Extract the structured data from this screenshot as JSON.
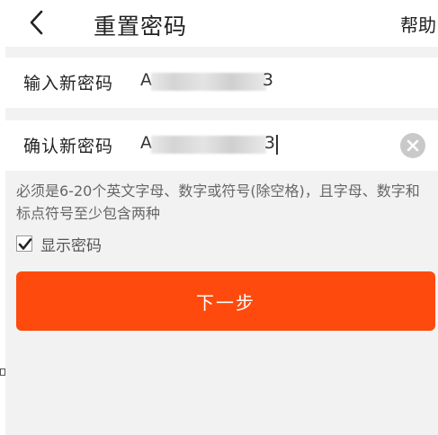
{
  "header": {
    "title": "重置密码",
    "help_label": "帮助"
  },
  "form": {
    "new_password": {
      "label": "输入新密码",
      "value_start": "A",
      "value_end": "3"
    },
    "confirm_password": {
      "label": "确认新密码",
      "value_start": "A",
      "value_end": "3"
    }
  },
  "hint": "必须是6-20个英文字母、数字或符号(除空格)，且字母、数字和标点符号至少包含两种",
  "show_password": {
    "label": "显示密码",
    "checked": true
  },
  "next_button": {
    "label": "下一步"
  },
  "colors": {
    "accent": "#ff4a0d",
    "page_background": "#f2f2f2",
    "clear_icon": "#c9c9c9"
  },
  "icons": {
    "back": "chevron-left-icon",
    "clear": "clear-icon",
    "check": "checkmark-icon"
  }
}
